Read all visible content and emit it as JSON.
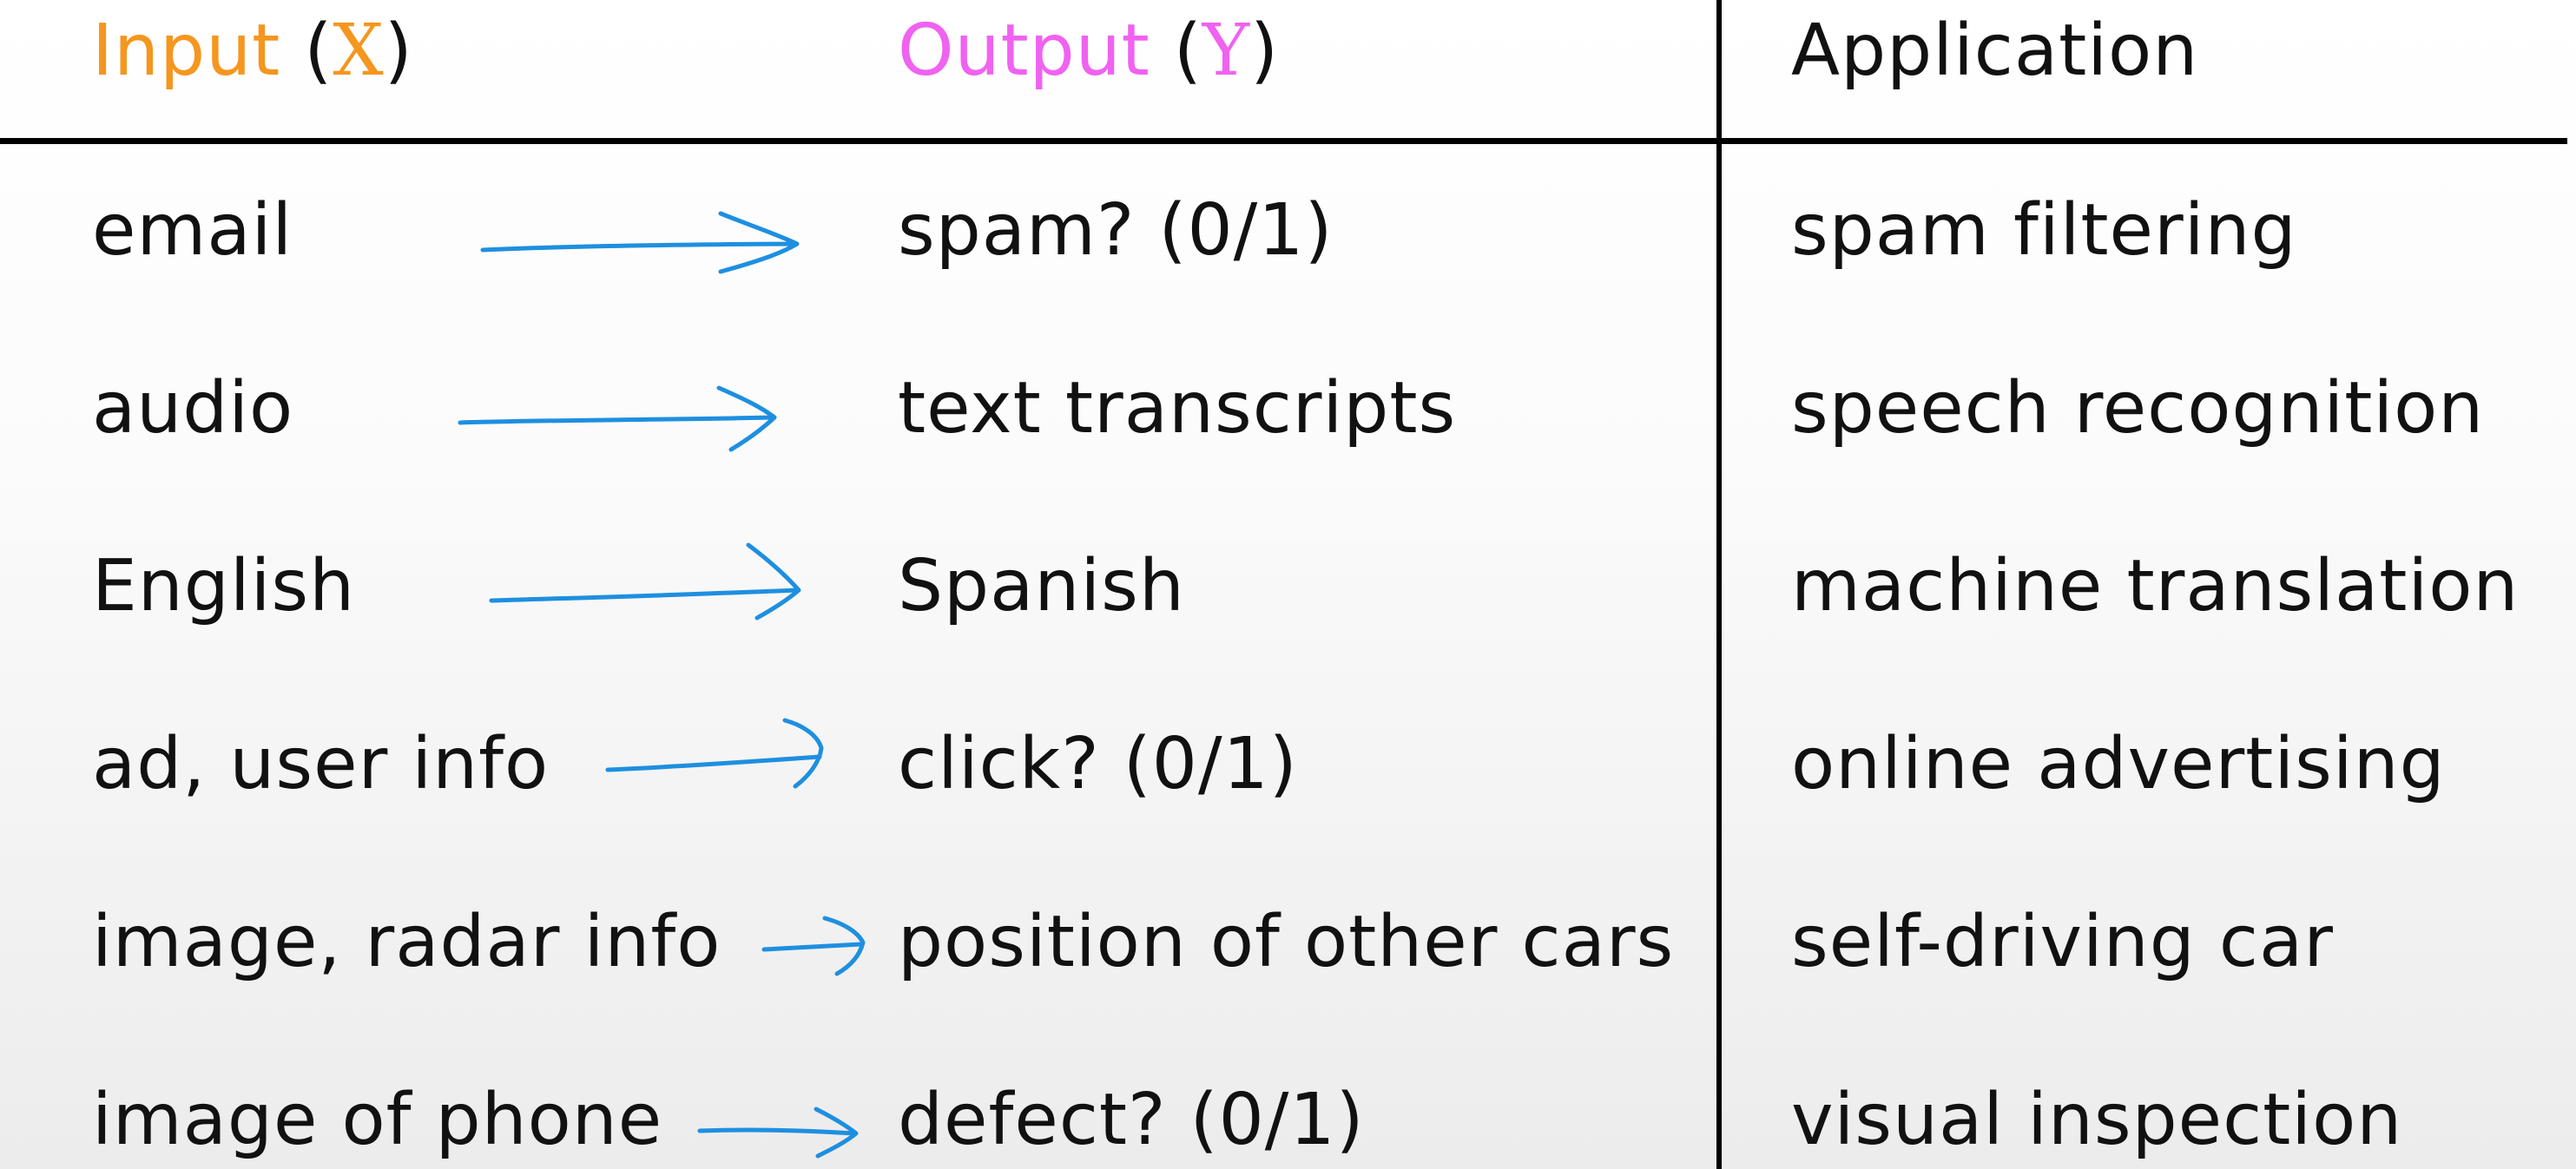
{
  "colors": {
    "input_accent": "#f5961e",
    "output_accent": "#f062f0",
    "arrow": "#1e8fe0",
    "text": "#111111",
    "rule": "#000000"
  },
  "header": {
    "input_label": "Input",
    "input_var": "X",
    "output_label": "Output",
    "output_var": "Y",
    "application_label": "Application",
    "open_paren": "(",
    "close_paren": ")"
  },
  "rows": [
    {
      "input": "email",
      "output": "spam? (0/1)",
      "application": "spam filtering",
      "arrow_icon": "right-arrow-icon"
    },
    {
      "input": "audio",
      "output": "text transcripts",
      "application": "speech recognition",
      "arrow_icon": "right-arrow-icon"
    },
    {
      "input": "English",
      "output": "Spanish",
      "application": "machine translation",
      "arrow_icon": "right-arrow-icon"
    },
    {
      "input": "ad, user info",
      "output": "click? (0/1)",
      "application": "online advertising",
      "arrow_icon": "right-arrow-icon"
    },
    {
      "input": "image, radar info",
      "output": "position of other cars",
      "application": "self-driving car",
      "arrow_icon": "right-arrow-icon"
    },
    {
      "input": "image of phone",
      "output": "defect? (0/1)",
      "application": "visual inspection",
      "arrow_icon": "right-arrow-icon"
    }
  ]
}
